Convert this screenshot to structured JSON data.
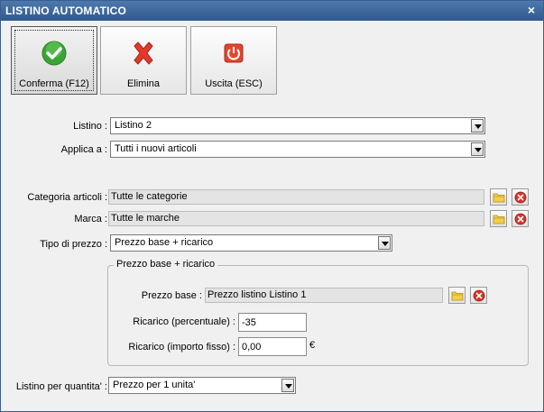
{
  "window": {
    "title": "LISTINO AUTOMATICO",
    "close_glyph": "×"
  },
  "toolbar": {
    "confirm_label": "Conferma (F12)",
    "delete_label": "Elimina",
    "exit_label": "Uscita (ESC)",
    "confirm_icon": "check-circle-icon",
    "delete_icon": "red-x-icon",
    "exit_icon": "power-icon"
  },
  "form": {
    "listino_label": "Listino :",
    "listino_value": "Listino 2",
    "applica_label": "Applica a :",
    "applica_value": "Tutti i nuovi articoli",
    "categoria_label": "Categoria articoli :",
    "categoria_value": "Tutte le categorie",
    "marca_label": "Marca :",
    "marca_value": "Tutte le marche",
    "tipo_label": "Tipo di prezzo :",
    "tipo_value": "Prezzo base + ricarico",
    "group_title": "Prezzo base + ricarico",
    "prezzo_base_label": "Prezzo base :",
    "prezzo_base_value": "Prezzo listino Listino 1",
    "ricarico_perc_label": "Ricarico (percentuale) :",
    "ricarico_perc_value": "-35",
    "ricarico_fisso_label": "Ricarico (importo fisso) :",
    "ricarico_fisso_value": "0,00",
    "currency": "€",
    "quantita_label": "Listino per quantita' :",
    "quantita_value": "Prezzo per 1 unita'"
  },
  "colors": {
    "titlebar": "#2f5a8f",
    "accent_green": "#3aa435",
    "accent_red": "#e0392b",
    "folder_yellow": "#f2cf4a"
  }
}
